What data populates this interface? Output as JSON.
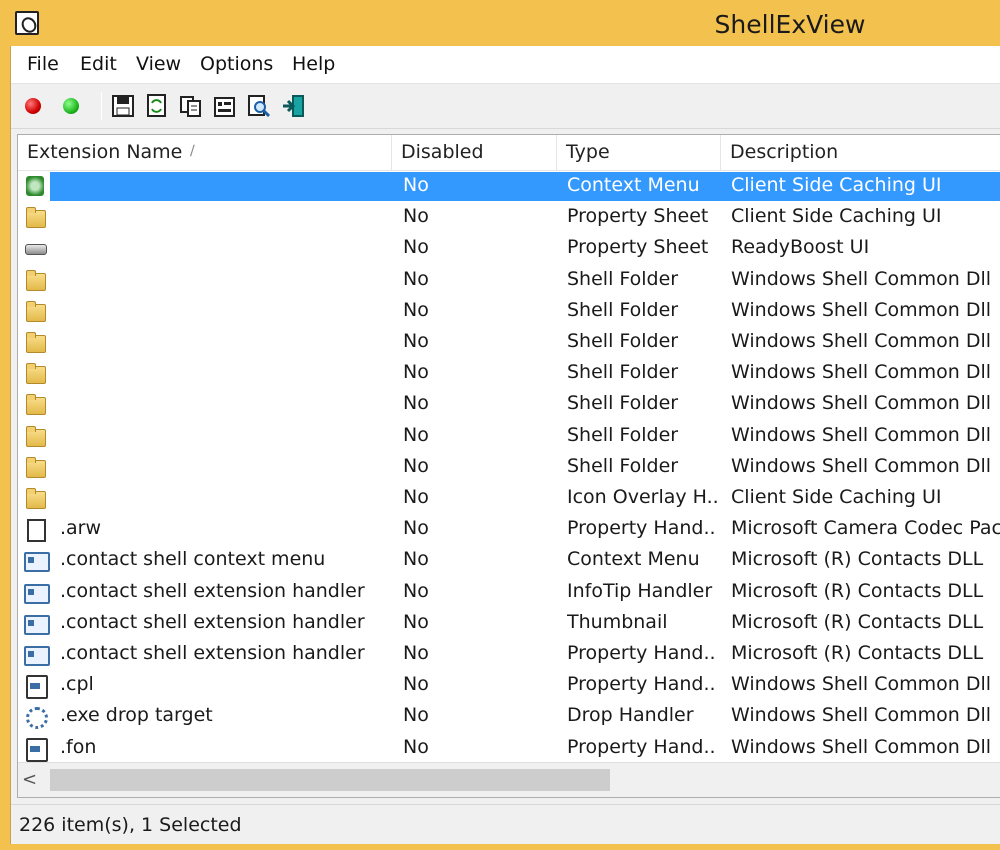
{
  "window": {
    "title": "ShellExView"
  },
  "menu": [
    "File",
    "Edit",
    "View",
    "Options",
    "Help"
  ],
  "toolbar": [
    "disable-icon",
    "enable-icon",
    "save-icon",
    "refresh-icon",
    "copy-icon",
    "properties-icon",
    "find-icon",
    "exit-icon"
  ],
  "columns": [
    "Extension Name",
    "Disabled",
    "Type",
    "Description"
  ],
  "rows": [
    {
      "name": "",
      "disabled": "No",
      "type": "Context Menu",
      "description": "Client Side Caching UI",
      "icon": "sync",
      "selected": true
    },
    {
      "name": "",
      "disabled": "No",
      "type": "Property Sheet",
      "description": "Client Side Caching UI",
      "icon": "folder-sync"
    },
    {
      "name": "",
      "disabled": "No",
      "type": "Property Sheet",
      "description": "ReadyBoost UI",
      "icon": "drive"
    },
    {
      "name": "",
      "disabled": "No",
      "type": "Shell Folder",
      "description": "Windows Shell Common Dll",
      "icon": "folder"
    },
    {
      "name": "",
      "disabled": "No",
      "type": "Shell Folder",
      "description": "Windows Shell Common Dll",
      "icon": "folder"
    },
    {
      "name": "",
      "disabled": "No",
      "type": "Shell Folder",
      "description": "Windows Shell Common Dll",
      "icon": "folder"
    },
    {
      "name": "",
      "disabled": "No",
      "type": "Shell Folder",
      "description": "Windows Shell Common Dll",
      "icon": "folder"
    },
    {
      "name": "",
      "disabled": "No",
      "type": "Shell Folder",
      "description": "Windows Shell Common Dll",
      "icon": "folder"
    },
    {
      "name": "",
      "disabled": "No",
      "type": "Shell Folder",
      "description": "Windows Shell Common Dll",
      "icon": "folder"
    },
    {
      "name": "",
      "disabled": "No",
      "type": "Shell Folder",
      "description": "Windows Shell Common Dll",
      "icon": "folder"
    },
    {
      "name": "",
      "disabled": "No",
      "type": "Icon Overlay H...",
      "description": "Client Side Caching UI",
      "icon": "folder-sync"
    },
    {
      "name": ".arw",
      "disabled": "No",
      "type": "Property Hand...",
      "description": "Microsoft Camera Codec Pack",
      "icon": "doc"
    },
    {
      "name": ".contact shell context menu",
      "disabled": "No",
      "type": "Context Menu",
      "description": "Microsoft (R) Contacts DLL",
      "icon": "card"
    },
    {
      "name": ".contact shell extension handler",
      "disabled": "No",
      "type": "InfoTip Handler",
      "description": "Microsoft (R) Contacts DLL",
      "icon": "card"
    },
    {
      "name": ".contact shell extension handler",
      "disabled": "No",
      "type": "Thumbnail",
      "description": "Microsoft (R) Contacts DLL",
      "icon": "card"
    },
    {
      "name": ".contact shell extension handler",
      "disabled": "No",
      "type": "Property Hand...",
      "description": "Microsoft (R) Contacts DLL",
      "icon": "card"
    },
    {
      "name": ".cpl",
      "disabled": "No",
      "type": "Property Hand...",
      "description": "Windows Shell Common Dll",
      "icon": "cpl"
    },
    {
      "name": ".exe drop target",
      "disabled": "No",
      "type": "Drop Handler",
      "description": "Windows Shell Common Dll",
      "icon": "gear"
    },
    {
      "name": ".fon",
      "disabled": "No",
      "type": "Property Hand...",
      "description": "Windows Shell Common Dll",
      "icon": "cpl"
    }
  ],
  "status": "226 item(s), 1 Selected"
}
